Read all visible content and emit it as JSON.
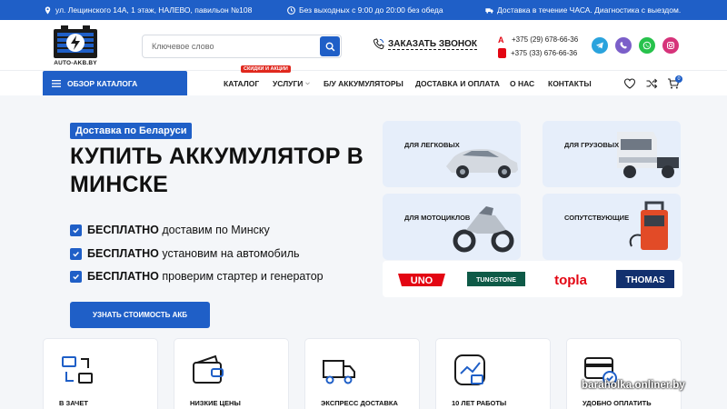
{
  "topbar": {
    "address": "ул. Лещинского 14А, 1 этаж, НАЛЕВО, павильон №108",
    "hours": "Без выходных с 9:00 до 20:00 без обеда",
    "delivery": "Доставка в течение ЧАСА. Диагностика с выездом."
  },
  "header": {
    "logo_text": "AUTO-AKB.BY",
    "search_placeholder": "Ключевое слово",
    "callback_label": "ЗАКАЗАТЬ ЗВОНОК",
    "phones": [
      {
        "operator": "A1",
        "number": "+375 (29) 678-66-36"
      },
      {
        "operator": "MTS",
        "number": "+375 (33) 676-66-36"
      }
    ],
    "socials": [
      "telegram-icon",
      "viber-icon",
      "whatsapp-icon",
      "instagram-icon"
    ]
  },
  "nav": {
    "catalog_label": "ОБЗОР КАТАЛОГА",
    "promo_badge": "СКИДКИ И АКЦИИ",
    "links": [
      "КАТАЛОГ",
      "УСЛУГИ",
      "Б/У АККУМУЛЯТОРЫ",
      "ДОСТАВКА И ОПЛАТА",
      "О НАС",
      "КОНТАКТЫ"
    ],
    "cart_count": "0"
  },
  "hero": {
    "badge": "Доставка по Беларуси",
    "title": "КУПИТЬ АККУМУЛЯТОР В МИНСКЕ",
    "benefits": [
      {
        "bold": "БЕСПЛАТНО",
        "text": " доставим по Минску"
      },
      {
        "bold": "БЕСПЛАТНО",
        "text": " установим на автомобиль"
      },
      {
        "bold": "БЕСПЛАТНО",
        "text": " проверим стартер и генератор"
      }
    ],
    "cta_label": "УЗНАТЬ СТОИМОСТЬ АКБ"
  },
  "categories": [
    "ДЛЯ ЛЕГКОВЫХ",
    "ДЛЯ ГРУЗОВЫХ",
    "ДЛЯ МОТОЦИКЛОВ",
    "СОПУТСТВУЮЩИЕ"
  ],
  "brands": [
    "UNO",
    "TUNGSTONE",
    "topla",
    "THOMAS"
  ],
  "features": [
    "В ЗАЧЕТ",
    "НИЗКИЕ ЦЕНЫ",
    "ЭКСПРЕСС ДОСТАВКА",
    "10 ЛЕТ РАБОТЫ",
    "УДОБНО ОПЛАТИТЬ"
  ],
  "watermark": "baraholka.onliner.by",
  "colors": {
    "brand_blue": "#1f5fc7",
    "accent_red": "#e0281e",
    "hero_bg": "#f4f6f9",
    "card_bg": "#e6eefa"
  }
}
